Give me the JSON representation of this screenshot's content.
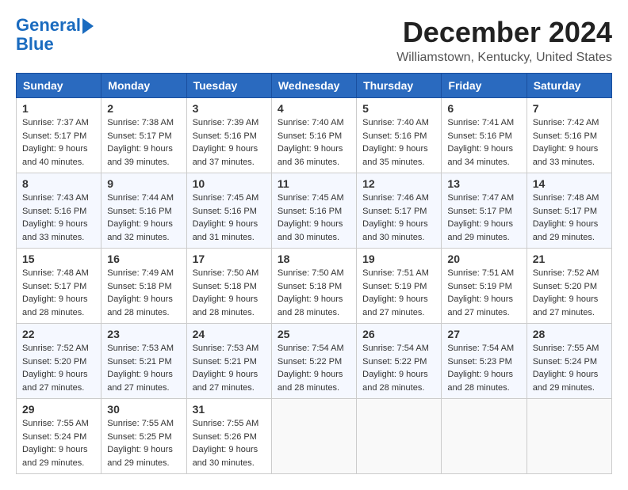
{
  "logo": {
    "line1": "General",
    "line2": "Blue"
  },
  "title": "December 2024",
  "location": "Williamstown, Kentucky, United States",
  "headers": [
    "Sunday",
    "Monday",
    "Tuesday",
    "Wednesday",
    "Thursday",
    "Friday",
    "Saturday"
  ],
  "weeks": [
    [
      {
        "day": "1",
        "info": "Sunrise: 7:37 AM\nSunset: 5:17 PM\nDaylight: 9 hours and 40 minutes."
      },
      {
        "day": "2",
        "info": "Sunrise: 7:38 AM\nSunset: 5:17 PM\nDaylight: 9 hours and 39 minutes."
      },
      {
        "day": "3",
        "info": "Sunrise: 7:39 AM\nSunset: 5:16 PM\nDaylight: 9 hours and 37 minutes."
      },
      {
        "day": "4",
        "info": "Sunrise: 7:40 AM\nSunset: 5:16 PM\nDaylight: 9 hours and 36 minutes."
      },
      {
        "day": "5",
        "info": "Sunrise: 7:40 AM\nSunset: 5:16 PM\nDaylight: 9 hours and 35 minutes."
      },
      {
        "day": "6",
        "info": "Sunrise: 7:41 AM\nSunset: 5:16 PM\nDaylight: 9 hours and 34 minutes."
      },
      {
        "day": "7",
        "info": "Sunrise: 7:42 AM\nSunset: 5:16 PM\nDaylight: 9 hours and 33 minutes."
      }
    ],
    [
      {
        "day": "8",
        "info": "Sunrise: 7:43 AM\nSunset: 5:16 PM\nDaylight: 9 hours and 33 minutes."
      },
      {
        "day": "9",
        "info": "Sunrise: 7:44 AM\nSunset: 5:16 PM\nDaylight: 9 hours and 32 minutes."
      },
      {
        "day": "10",
        "info": "Sunrise: 7:45 AM\nSunset: 5:16 PM\nDaylight: 9 hours and 31 minutes."
      },
      {
        "day": "11",
        "info": "Sunrise: 7:45 AM\nSunset: 5:16 PM\nDaylight: 9 hours and 30 minutes."
      },
      {
        "day": "12",
        "info": "Sunrise: 7:46 AM\nSunset: 5:17 PM\nDaylight: 9 hours and 30 minutes."
      },
      {
        "day": "13",
        "info": "Sunrise: 7:47 AM\nSunset: 5:17 PM\nDaylight: 9 hours and 29 minutes."
      },
      {
        "day": "14",
        "info": "Sunrise: 7:48 AM\nSunset: 5:17 PM\nDaylight: 9 hours and 29 minutes."
      }
    ],
    [
      {
        "day": "15",
        "info": "Sunrise: 7:48 AM\nSunset: 5:17 PM\nDaylight: 9 hours and 28 minutes."
      },
      {
        "day": "16",
        "info": "Sunrise: 7:49 AM\nSunset: 5:18 PM\nDaylight: 9 hours and 28 minutes."
      },
      {
        "day": "17",
        "info": "Sunrise: 7:50 AM\nSunset: 5:18 PM\nDaylight: 9 hours and 28 minutes."
      },
      {
        "day": "18",
        "info": "Sunrise: 7:50 AM\nSunset: 5:18 PM\nDaylight: 9 hours and 28 minutes."
      },
      {
        "day": "19",
        "info": "Sunrise: 7:51 AM\nSunset: 5:19 PM\nDaylight: 9 hours and 27 minutes."
      },
      {
        "day": "20",
        "info": "Sunrise: 7:51 AM\nSunset: 5:19 PM\nDaylight: 9 hours and 27 minutes."
      },
      {
        "day": "21",
        "info": "Sunrise: 7:52 AM\nSunset: 5:20 PM\nDaylight: 9 hours and 27 minutes."
      }
    ],
    [
      {
        "day": "22",
        "info": "Sunrise: 7:52 AM\nSunset: 5:20 PM\nDaylight: 9 hours and 27 minutes."
      },
      {
        "day": "23",
        "info": "Sunrise: 7:53 AM\nSunset: 5:21 PM\nDaylight: 9 hours and 27 minutes."
      },
      {
        "day": "24",
        "info": "Sunrise: 7:53 AM\nSunset: 5:21 PM\nDaylight: 9 hours and 27 minutes."
      },
      {
        "day": "25",
        "info": "Sunrise: 7:54 AM\nSunset: 5:22 PM\nDaylight: 9 hours and 28 minutes."
      },
      {
        "day": "26",
        "info": "Sunrise: 7:54 AM\nSunset: 5:22 PM\nDaylight: 9 hours and 28 minutes."
      },
      {
        "day": "27",
        "info": "Sunrise: 7:54 AM\nSunset: 5:23 PM\nDaylight: 9 hours and 28 minutes."
      },
      {
        "day": "28",
        "info": "Sunrise: 7:55 AM\nSunset: 5:24 PM\nDaylight: 9 hours and 29 minutes."
      }
    ],
    [
      {
        "day": "29",
        "info": "Sunrise: 7:55 AM\nSunset: 5:24 PM\nDaylight: 9 hours and 29 minutes."
      },
      {
        "day": "30",
        "info": "Sunrise: 7:55 AM\nSunset: 5:25 PM\nDaylight: 9 hours and 29 minutes."
      },
      {
        "day": "31",
        "info": "Sunrise: 7:55 AM\nSunset: 5:26 PM\nDaylight: 9 hours and 30 minutes."
      },
      null,
      null,
      null,
      null
    ]
  ]
}
